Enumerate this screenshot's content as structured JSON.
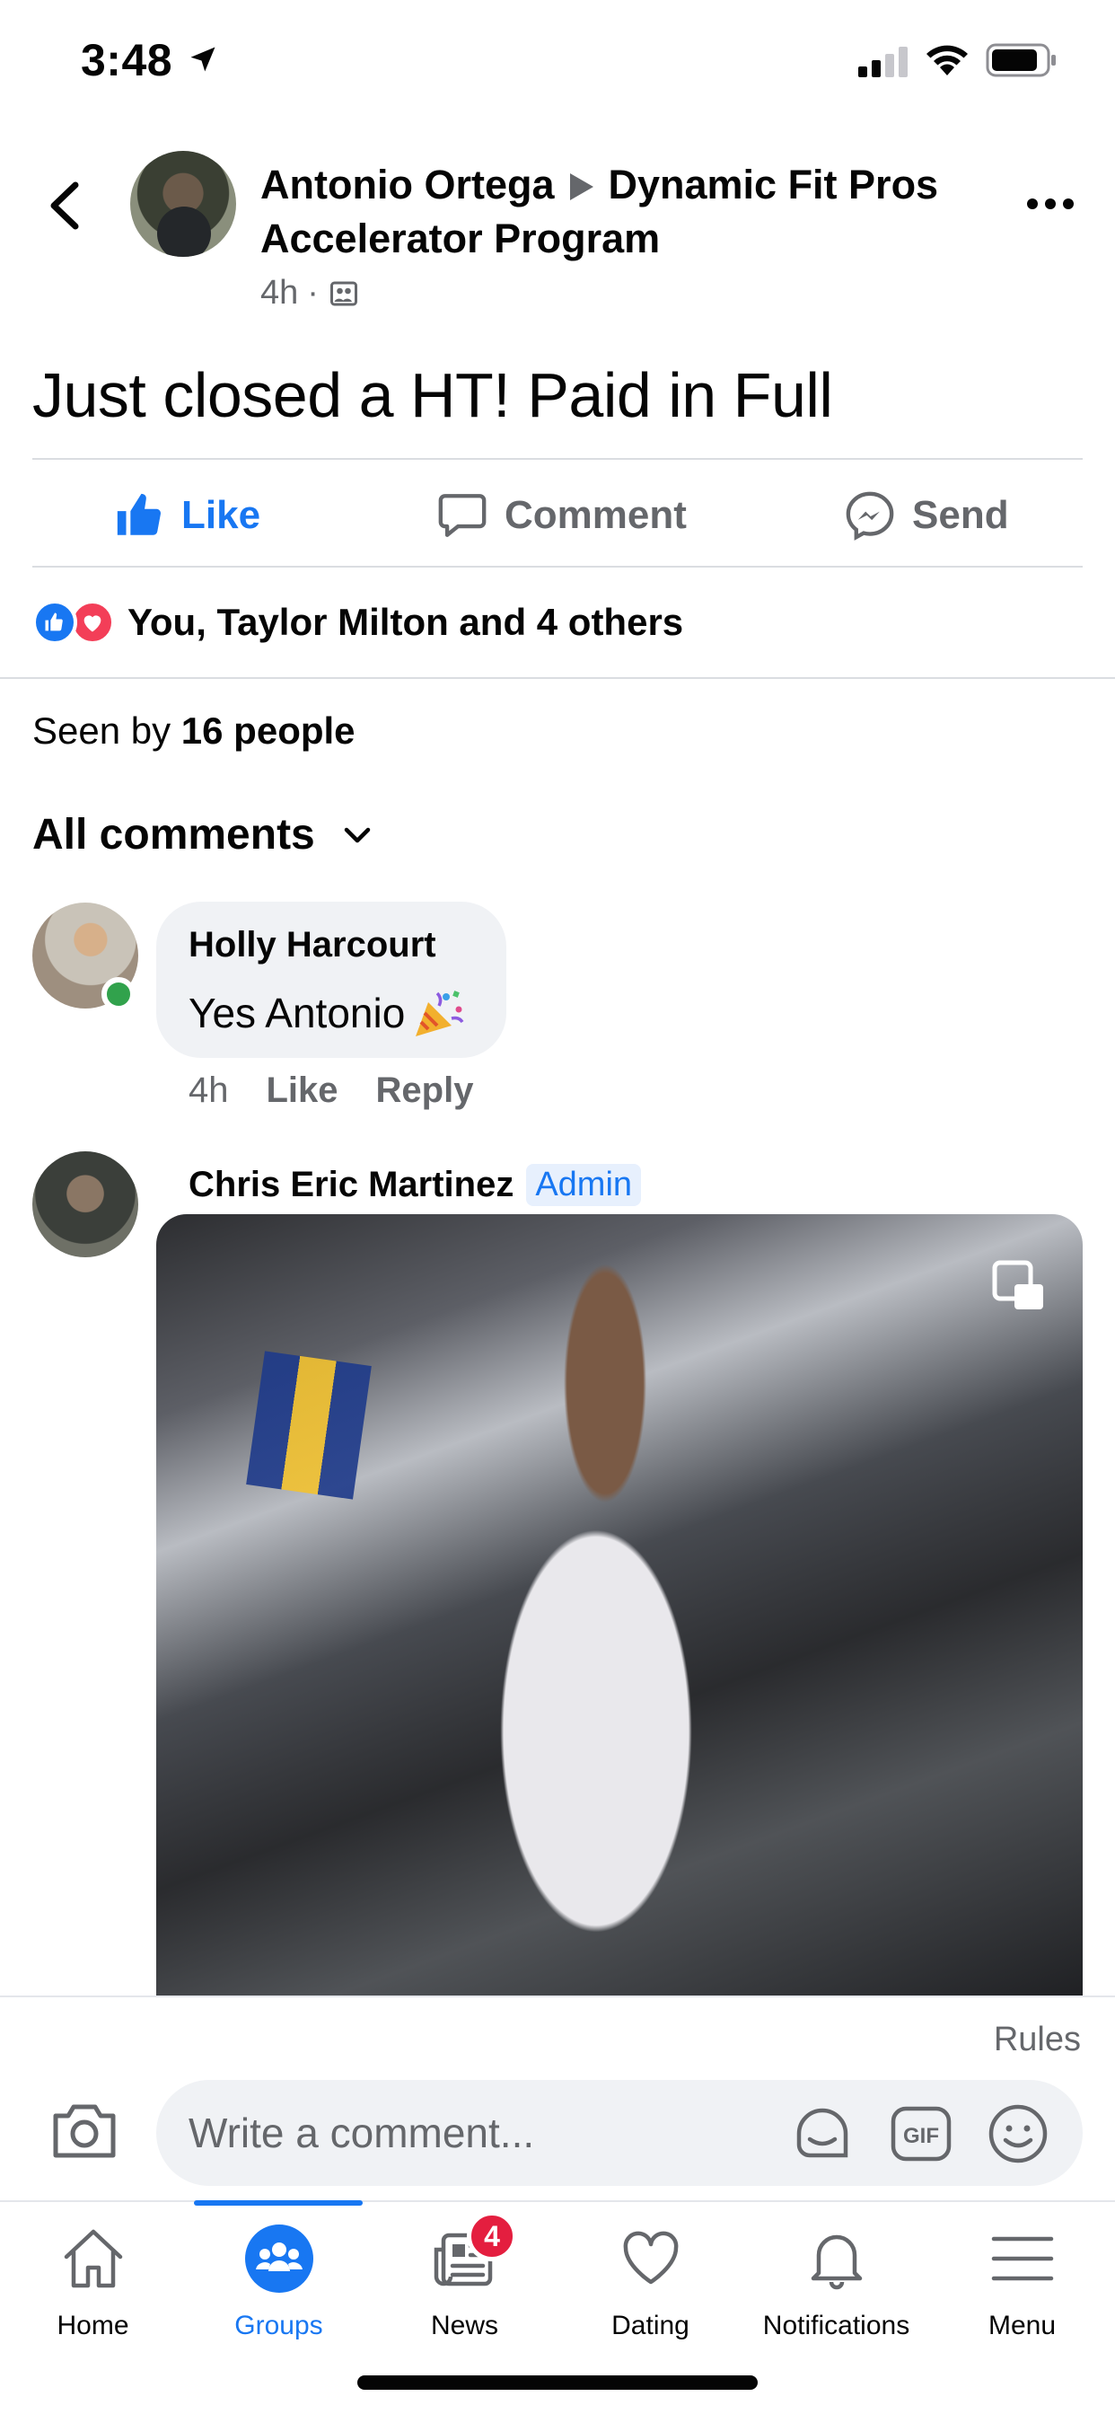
{
  "status_bar": {
    "time": "3:48",
    "icons": [
      "location-arrow-icon",
      "cellular-signal-icon",
      "wifi-icon",
      "battery-icon"
    ]
  },
  "post": {
    "author": "Antonio Ortega",
    "group_line1": "Dynamic Fit Pros",
    "group_line2": "Accelerator Program",
    "age": "4h",
    "separator": "·",
    "text": "Just closed a HT! Paid in Full"
  },
  "actions": {
    "like": "Like",
    "comment": "Comment",
    "send": "Send"
  },
  "reactions": {
    "summary": "You, Taylor Milton and 4 others",
    "types": [
      "like",
      "love"
    ]
  },
  "seen_by": {
    "prefix": "Seen by",
    "count": "16 people"
  },
  "comments_filter": {
    "label": "All comments"
  },
  "comments": [
    {
      "author": "Holly Harcourt",
      "text": "Yes Antonio",
      "emoji": "party-popper-icon",
      "age": "4h",
      "like": "Like",
      "reply": "Reply"
    },
    {
      "author": "Chris Eric Martinez",
      "badge": "Admin",
      "media": "gif"
    }
  ],
  "composer": {
    "rules": "Rules",
    "placeholder": "Write a comment..."
  },
  "tabs": [
    {
      "label": "Home",
      "icon": "home-icon"
    },
    {
      "label": "Groups",
      "icon": "groups-icon",
      "active": true
    },
    {
      "label": "News",
      "icon": "news-icon",
      "badge": "4"
    },
    {
      "label": "Dating",
      "icon": "heart-icon"
    },
    {
      "label": "Notifications",
      "icon": "bell-icon"
    },
    {
      "label": "Menu",
      "icon": "menu-icon"
    }
  ],
  "colors": {
    "accent": "#1877f2",
    "secondary_text": "#65676b",
    "bubble": "#f0f2f5",
    "badge": "#e41e3f",
    "online": "#31a24c",
    "love": "#f33e58"
  }
}
